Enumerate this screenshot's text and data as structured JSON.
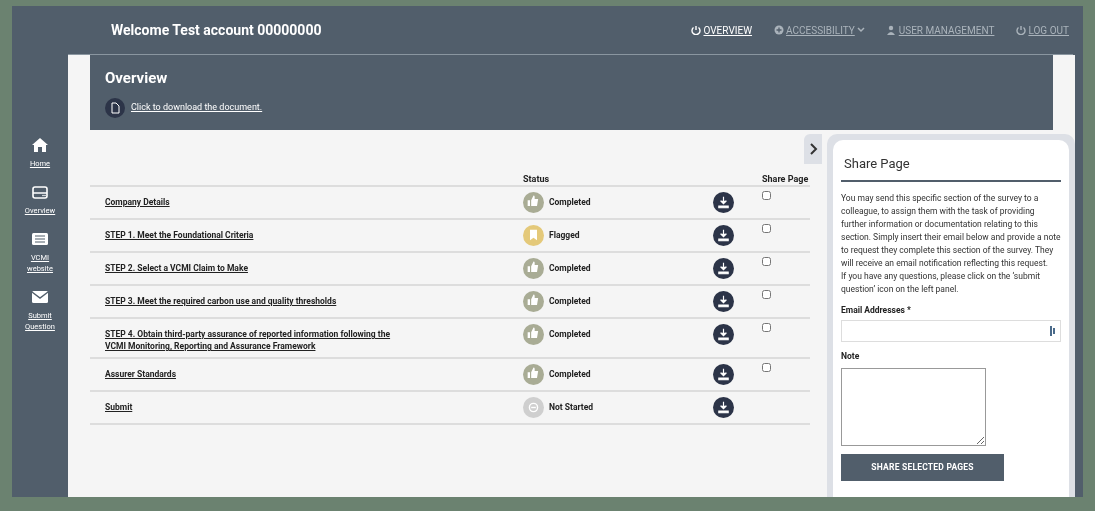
{
  "header": {
    "welcome": "Welcome Test account 00000000",
    "nav": [
      {
        "label": "OVERVIEW",
        "kind": "power",
        "selected": true
      },
      {
        "label": "ACCESSIBILITY",
        "kind": "plus",
        "selected": false,
        "dropdown": true
      },
      {
        "label": "USER MANAGEMENT",
        "kind": "user",
        "selected": false
      },
      {
        "label": "LOG OUT",
        "kind": "power",
        "selected": false
      }
    ]
  },
  "sidebar": {
    "items": [
      {
        "label": "Home",
        "kind": "home"
      },
      {
        "label": "Overview",
        "kind": "drive"
      },
      {
        "label": "VCMI website",
        "kind": "list"
      },
      {
        "label": "Submit Question",
        "kind": "mail"
      }
    ]
  },
  "overview": {
    "title": "Overview",
    "download_link": "Click to download the document."
  },
  "table": {
    "columns": [
      "Status",
      "Share Page"
    ],
    "rows": [
      {
        "name": "Company Details",
        "status": "Completed",
        "kind": "completed",
        "checked": false
      },
      {
        "name": "STEP 1. Meet the Foundational Criteria",
        "status": "Flagged",
        "kind": "flagged",
        "checked": false
      },
      {
        "name": "STEP 2. Select a VCMI Claim to Make",
        "status": "Completed",
        "kind": "completed",
        "checked": false
      },
      {
        "name": "STEP 3. Meet the required carbon use and quality thresholds",
        "status": "Completed",
        "kind": "completed",
        "checked": false
      },
      {
        "name": "STEP 4. Obtain third-party assurance of reported information following the VCMI Monitoring, Reporting and Assurance Framework",
        "status": "Completed",
        "kind": "completed",
        "checked": false
      },
      {
        "name": "Assurer Standards",
        "status": "Completed",
        "kind": "completed",
        "checked": false
      },
      {
        "name": "Submit",
        "status": "Not Started",
        "kind": "not_started"
      }
    ]
  },
  "share_panel": {
    "title": "Share Page",
    "description": "You may send this specific section of the survey to a colleague, to assign them with the task of providing further information or documentation relating to this section. Simply insert their email below and provide a note to request they complete this section of the survey. They will receive an email notification reflecting this request.",
    "help": "If you have any questions, please click on the ‘submit question’ icon on the left panel.",
    "email_label": "Email Addresses *",
    "note_label": "Note",
    "button": "SHARE SELECTED PAGES"
  }
}
